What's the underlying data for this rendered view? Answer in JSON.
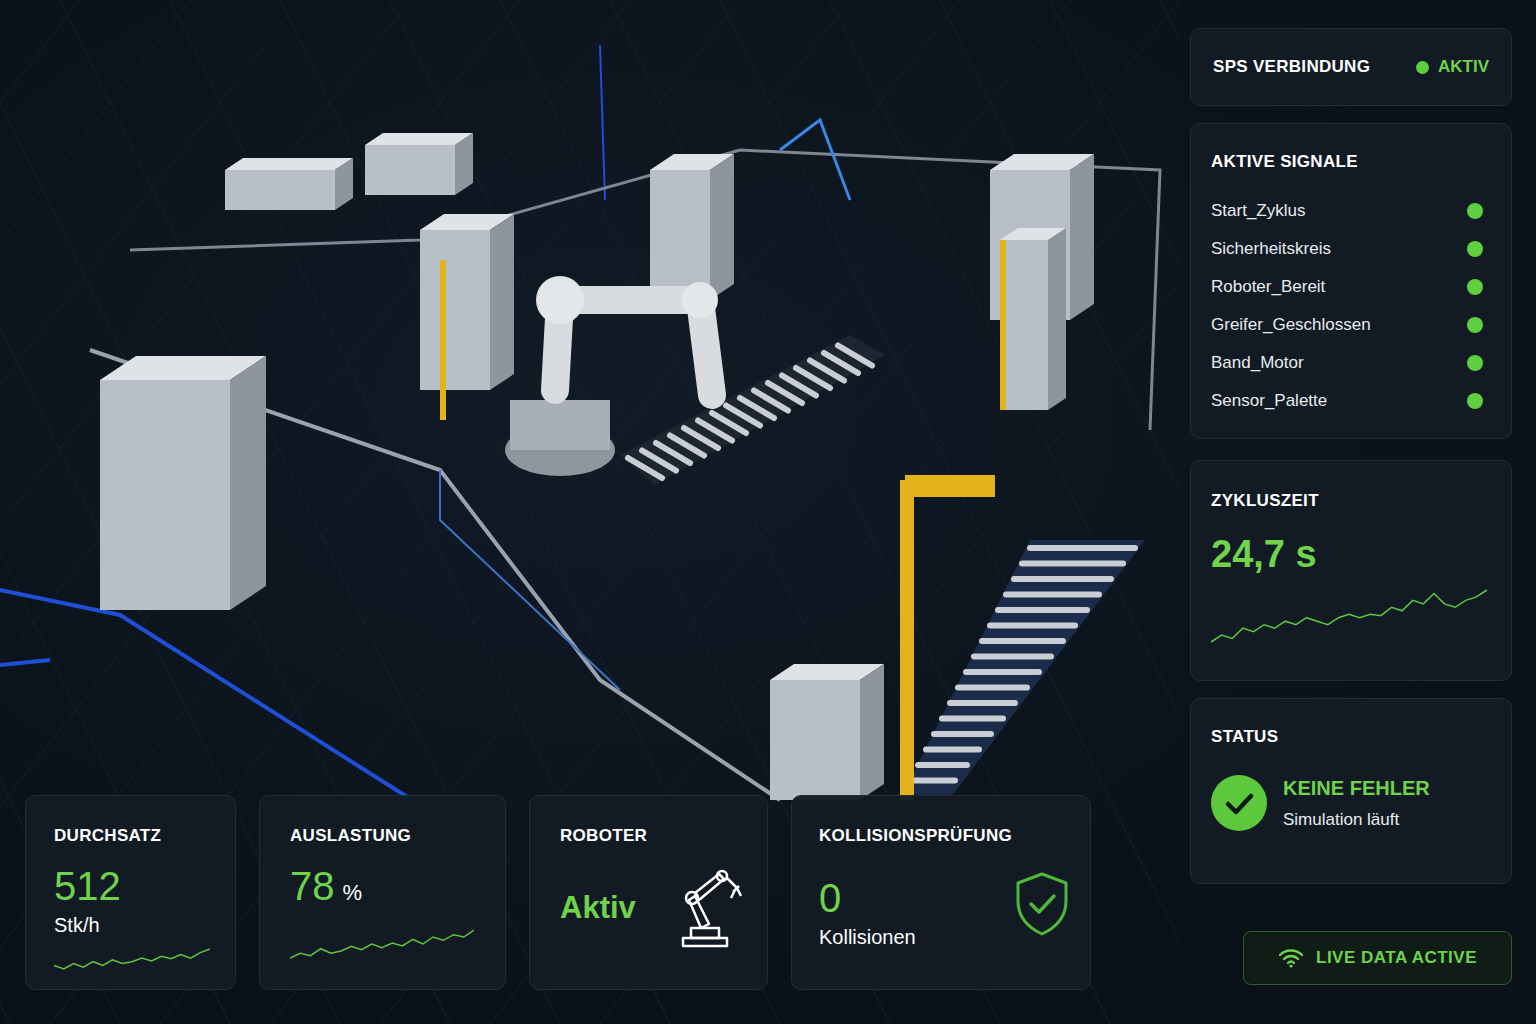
{
  "connection": {
    "label": "SPS VERBINDUNG",
    "status": "AKTIV",
    "on": true
  },
  "signals": {
    "title": "AKTIVE SIGNALE",
    "items": [
      {
        "name": "Start_Zyklus",
        "on": true
      },
      {
        "name": "Sicherheitskreis",
        "on": true
      },
      {
        "name": "Roboter_Bereit",
        "on": true
      },
      {
        "name": "Greifer_Geschlossen",
        "on": true
      },
      {
        "name": "Band_Motor",
        "on": true
      },
      {
        "name": "Sensor_Palette",
        "on": true
      }
    ]
  },
  "cycle_time": {
    "title": "ZYKLUSZEIT",
    "value": "24,7 s",
    "trend": [
      3,
      4,
      3.5,
      5,
      4.5,
      5.5,
      5,
      6,
      5.5,
      6.5,
      6,
      5.5,
      6.5,
      7,
      6.5,
      7,
      6.8,
      8,
      7.5,
      9,
      8.5,
      10,
      8.5,
      8,
      9,
      9.5,
      10.5
    ]
  },
  "status": {
    "title": "STATUS",
    "message": "KEINE FEHLER",
    "detail": "Simulation läuft",
    "ok": true
  },
  "live": {
    "label": "LIVE DATA ACTIVE",
    "on": true
  },
  "metrics": [
    {
      "kind": "rate",
      "title": "DURCHSATZ",
      "value": "512",
      "unit": "Stk/h",
      "trend": [
        3,
        2,
        3.5,
        2.5,
        4,
        3,
        4.5,
        3.5,
        4,
        5,
        4.2,
        5.5,
        4.8,
        6,
        5,
        6.5,
        7.5
      ]
    },
    {
      "kind": "percent",
      "title": "AUSLASTUNG",
      "value": "78",
      "unit": "%",
      "trend": [
        2,
        3,
        2.5,
        4,
        3,
        3.5,
        4.5,
        3.8,
        5,
        4.2,
        5.2,
        4.6,
        6,
        5,
        6.5,
        5.8,
        7,
        6.5,
        8
      ]
    },
    {
      "kind": "robot",
      "title": "ROBOTER",
      "value": "Aktiv"
    },
    {
      "kind": "shield",
      "title": "KOLLISIONSPRÜFUNG",
      "value": "0",
      "unit": "Kollisionen"
    }
  ]
}
